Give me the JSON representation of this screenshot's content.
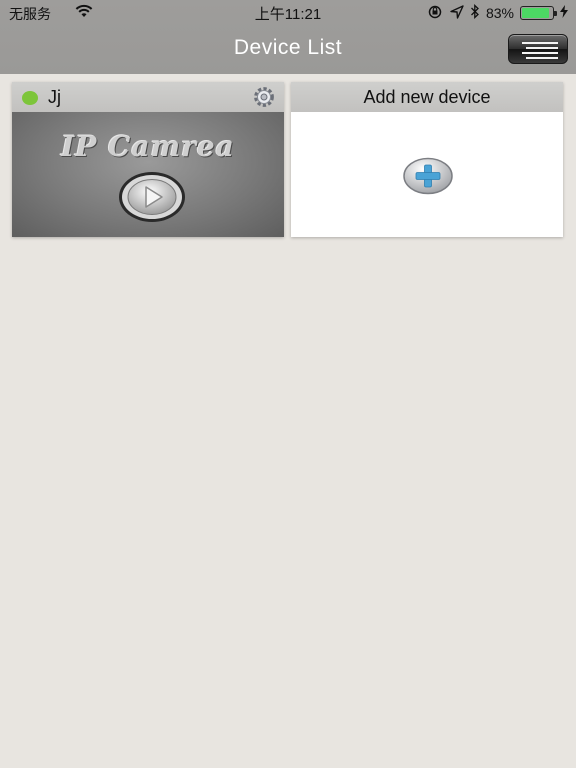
{
  "status_bar": {
    "carrier": "无服务",
    "time": "上午11:21",
    "battery_percent": "83%",
    "battery_level": 0.83,
    "icons": [
      "wifi-icon",
      "orientation-lock-icon",
      "location-icon",
      "bluetooth-icon",
      "charging-icon"
    ]
  },
  "nav": {
    "title": "Device List",
    "menu_icon": "list-menu-icon"
  },
  "devices": [
    {
      "name": "Jj",
      "status": "online",
      "status_color": "#7dc53a",
      "thumbnail_text": "IP Camrea",
      "settings_icon": "gear-icon",
      "play_icon": "play-icon"
    }
  ],
  "add_device": {
    "label": "Add new device",
    "icon": "plus-icon"
  },
  "colors": {
    "nav_bg": "#9c9b99",
    "page_bg": "#e8e5e0",
    "card_header": "#c6c5c3",
    "accent_blue": "#4aa3d6"
  }
}
